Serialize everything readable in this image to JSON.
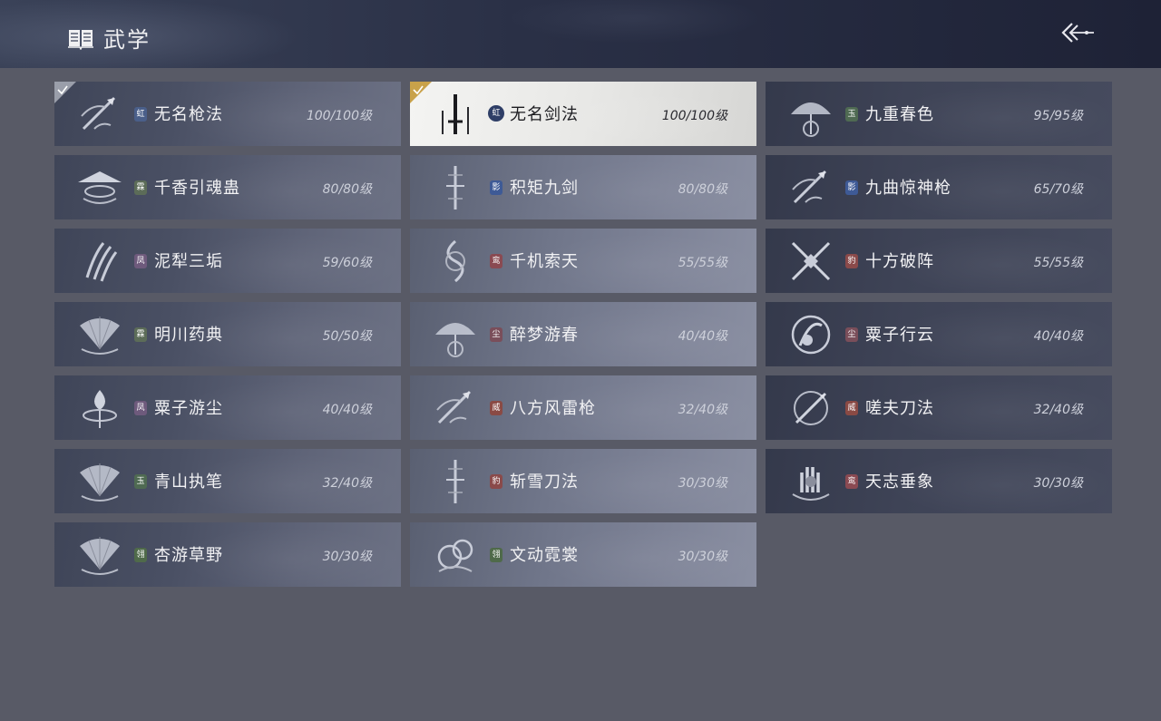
{
  "header": {
    "title": "武学",
    "book_icon": "book-icon",
    "back_icon": "back-arrow-icon"
  },
  "skills": [
    {
      "name": "无名枪法",
      "level": "100/100级",
      "badge": "虹",
      "badge_type": "hong",
      "equipped": true,
      "selected": false,
      "icon": "spear-icon"
    },
    {
      "name": "无名剑法",
      "level": "100/100级",
      "badge": "虹",
      "badge_type": "hong",
      "equipped": true,
      "selected": true,
      "icon": "sword-icon"
    },
    {
      "name": "九重春色",
      "level": "95/95级",
      "badge": "玉",
      "badge_type": "yu",
      "equipped": false,
      "selected": false,
      "icon": "umbrella-icon"
    },
    {
      "name": "千香引魂蛊",
      "level": "80/80级",
      "badge": "霖",
      "badge_type": "lin",
      "equipped": false,
      "selected": false,
      "icon": "hat-icon"
    },
    {
      "name": "积矩九剑",
      "level": "80/80级",
      "badge": "影",
      "badge_type": "ying",
      "equipped": false,
      "selected": false,
      "icon": "blade-icon"
    },
    {
      "name": "九曲惊神枪",
      "level": "65/70级",
      "badge": "影",
      "badge_type": "ying",
      "equipped": false,
      "selected": false,
      "icon": "spear-icon"
    },
    {
      "name": "泥犁三垢",
      "level": "59/60级",
      "badge": "凤",
      "badge_type": "feng",
      "equipped": false,
      "selected": false,
      "icon": "claw-icon"
    },
    {
      "name": "千机索天",
      "level": "55/55级",
      "badge": "鸾",
      "badge_type": "gui",
      "equipped": false,
      "selected": false,
      "icon": "rope-icon"
    },
    {
      "name": "十方破阵",
      "level": "55/55级",
      "badge": "豹",
      "badge_type": "bao",
      "equipped": false,
      "selected": false,
      "icon": "cross-blades-icon"
    },
    {
      "name": "明川药典",
      "level": "50/50级",
      "badge": "霖",
      "badge_type": "lin",
      "equipped": false,
      "selected": false,
      "icon": "fan-icon"
    },
    {
      "name": "醉梦游春",
      "level": "40/40级",
      "badge": "尘",
      "badge_type": "chen",
      "equipped": false,
      "selected": false,
      "icon": "umbrella-icon"
    },
    {
      "name": "粟子行云",
      "level": "40/40级",
      "badge": "尘",
      "badge_type": "chen",
      "equipped": false,
      "selected": false,
      "icon": "swirl-icon"
    },
    {
      "name": "粟子游尘",
      "level": "40/40级",
      "badge": "凤",
      "badge_type": "feng",
      "equipped": false,
      "selected": false,
      "icon": "flame-icon"
    },
    {
      "name": "八方风雷枪",
      "level": "32/40级",
      "badge": "威",
      "badge_type": "wei",
      "equipped": false,
      "selected": false,
      "icon": "spear-icon"
    },
    {
      "name": "嗟夫刀法",
      "level": "32/40级",
      "badge": "威",
      "badge_type": "wei",
      "equipped": false,
      "selected": false,
      "icon": "saber-icon"
    },
    {
      "name": "青山执笔",
      "level": "32/40级",
      "badge": "玉",
      "badge_type": "yu",
      "equipped": false,
      "selected": false,
      "icon": "fan-icon"
    },
    {
      "name": "斩雪刀法",
      "level": "30/30级",
      "badge": "豹",
      "badge_type": "bao",
      "equipped": false,
      "selected": false,
      "icon": "blade-icon"
    },
    {
      "name": "天志垂象",
      "level": "30/30级",
      "badge": "鸾",
      "badge_type": "gui",
      "equipped": false,
      "selected": false,
      "icon": "hand-icon"
    },
    {
      "name": "杏游草野",
      "level": "30/30级",
      "badge": "翎",
      "badge_type": "xiang",
      "equipped": false,
      "selected": false,
      "icon": "fan-icon"
    },
    {
      "name": "文动霓裳",
      "level": "30/30级",
      "badge": "翎",
      "badge_type": "xiang",
      "equipped": false,
      "selected": false,
      "icon": "ribbon-icon"
    }
  ]
}
